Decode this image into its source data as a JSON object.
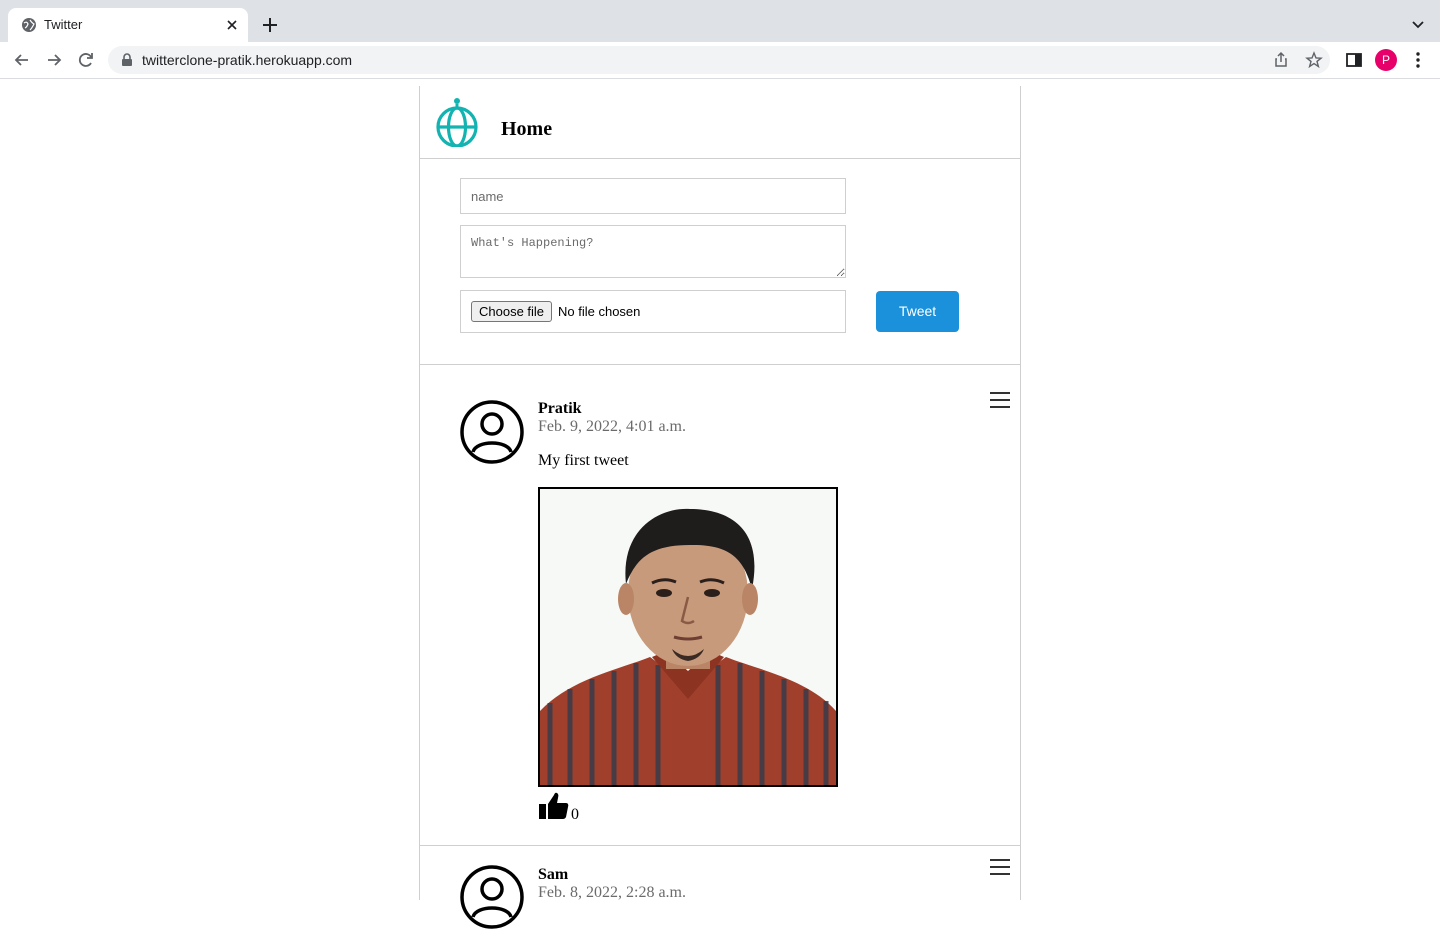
{
  "browser": {
    "tab_title": "Twitter",
    "url": "twitterclone-pratik.herokuapp.com",
    "profile_initial": "P"
  },
  "header": {
    "title": "Home"
  },
  "compose": {
    "name_placeholder": "name",
    "text_placeholder": "What's Happening?",
    "choose_file_label": "Choose file",
    "no_file_text": "No file chosen",
    "tweet_button": "Tweet"
  },
  "colors": {
    "accent": "#1a91da",
    "logo": "#12b3b0"
  },
  "tweets": [
    {
      "author": "Pratik",
      "timestamp": "Feb. 9, 2022, 4:01 a.m.",
      "text": "My first tweet",
      "likes": "0",
      "has_image": true
    },
    {
      "author": "Sam",
      "timestamp": "Feb. 8, 2022, 2:28 a.m."
    }
  ]
}
